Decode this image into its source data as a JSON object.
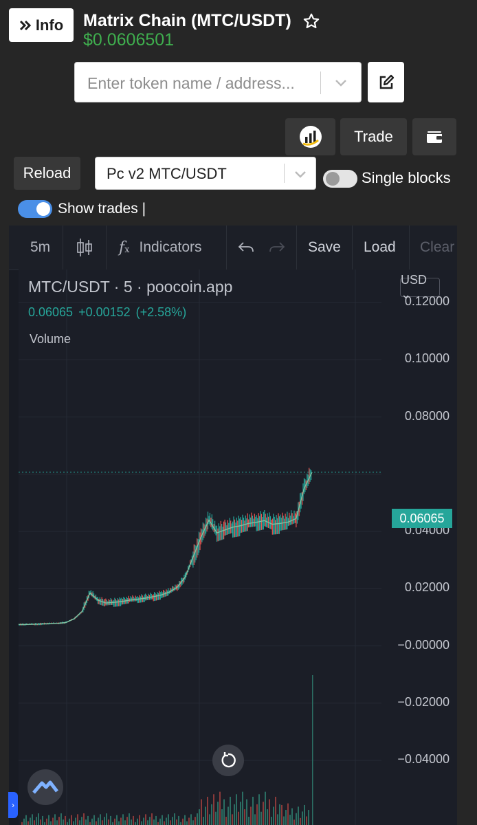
{
  "header": {
    "info_button": "Info",
    "title": "Matrix Chain (MTC/USDT)",
    "price": "$0.0606501"
  },
  "search": {
    "placeholder": "Enter token name / address..."
  },
  "actions": {
    "trade": "Trade",
    "reload": "Reload",
    "pair": "Pc v2 MTC/USDT",
    "single_blocks": "Single blocks",
    "show_trades": "Show trades |",
    "single_blocks_enabled": false,
    "show_trades_enabled": true
  },
  "chart_toolbar": {
    "interval": "5m",
    "indicators": "Indicators",
    "save": "Save",
    "load": "Load",
    "clear": "Clear"
  },
  "chart_legend": {
    "symbol": "MTC/USDT · 5 · poocoin.app",
    "values": "0.06065 +0.00152 (+2.58%)",
    "volume": "Volume",
    "currency": "USD ⌄",
    "last_price": "0.06065"
  },
  "colors": {
    "price_green": "#3fae4e",
    "up": "#26a69a",
    "down": "#ef5350",
    "toggle_on": "#4a8fe7",
    "chart_bg": "#1b1e27"
  },
  "chart_data": {
    "type": "line",
    "title": "MTC/USDT · 5 · poocoin.app",
    "xlabel": "",
    "ylabel": "",
    "y_ticks": [
      "0.12000",
      "0.10000",
      "0.08000",
      "0.04000",
      "0.02000",
      "−0.00000",
      "−0.02000",
      "−0.04000"
    ],
    "ylim": [
      -0.045,
      0.125
    ],
    "grid": true,
    "series": [
      {
        "values": [
          0.0075,
          0.0075,
          0.0076,
          0.0077,
          0.0078,
          0.0079,
          0.0082,
          0.0095,
          0.012,
          0.0185,
          0.016,
          0.015,
          0.0152,
          0.0155,
          0.016,
          0.0163,
          0.0167,
          0.0172,
          0.0178,
          0.0188,
          0.0205,
          0.024,
          0.031,
          0.038,
          0.044,
          0.0395,
          0.0405,
          0.0415,
          0.042,
          0.0428,
          0.0432,
          0.0438,
          0.0425,
          0.0428,
          0.0433,
          0.0445,
          0.055,
          0.0607
        ]
      }
    ]
  }
}
